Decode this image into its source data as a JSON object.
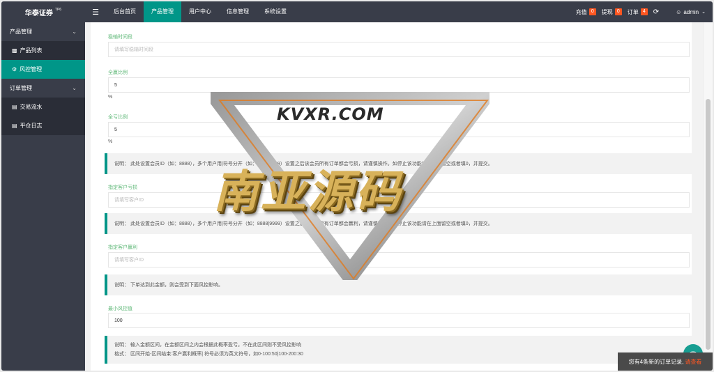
{
  "app": {
    "logo": "华泰证券",
    "logo_badge": "TP6"
  },
  "nav": {
    "toggle_icon": "hamburger-icon",
    "items": [
      {
        "label": "后台首页"
      },
      {
        "label": "产品管理"
      },
      {
        "label": "用户中心"
      },
      {
        "label": "信息管理"
      },
      {
        "label": "系统设置"
      }
    ],
    "active_index": 1
  },
  "top_right": {
    "recharge_label": "充值",
    "recharge_count": "0",
    "withdraw_label": "提现",
    "withdraw_count": "0",
    "order_label": "订单",
    "order_count": "4",
    "user": "admin"
  },
  "sidebar": {
    "groups": [
      {
        "label": "产品管理",
        "items": [
          {
            "label": "产品列表",
            "icon": "cube-icon"
          },
          {
            "label": "风控管理",
            "icon": "gear-icon",
            "active": true
          }
        ]
      },
      {
        "label": "订单管理",
        "items": [
          {
            "label": "交易流水",
            "icon": "list-icon"
          },
          {
            "label": "平仓日志",
            "icon": "list-icon"
          }
        ]
      }
    ]
  },
  "form": {
    "f1": {
      "label": "稳输时间段",
      "placeholder": "请填写稳输时间段",
      "value": ""
    },
    "f2": {
      "label": "全赢比例",
      "value": "5",
      "unit": "%"
    },
    "f3": {
      "label": "全亏比例",
      "value": "5",
      "unit": "%"
    },
    "note1": "说明： 此处设置会员ID（如：8888），多个用户用|符号分开（如：8888|9999）设置之后该会员所有订单都会亏损，请谨慎操作。如停止该功能请在上面留空或者填0，并提交。",
    "f4": {
      "label": "指定客户亏损",
      "placeholder": "请填写客户ID",
      "value": ""
    },
    "note2": "说明： 此处设置会员ID（如：8888），多个用户用|符号分开（如：8888|9999）设置之后该会员所有订单都会赢利，请谨慎操作。如停止该功能请在上面留空或者填0，并提交。",
    "f5": {
      "label": "指定客户赢利",
      "placeholder": "请填写客户ID",
      "value": ""
    },
    "note3": "说明： 下单达到此金额，则会受到下面风控影响。",
    "f6": {
      "label": "最小风控值",
      "value": "100"
    },
    "note4_line1": "说明： 输入金额区间，在金额区间之内会根据此概率盈亏。不在此区间则不受风控影响",
    "note4_line2": "格式： 区间开始-区间结束:客户赢利概率|      符号必须为英文符号，如0-100:50|100-200:30"
  },
  "watermark": {
    "url": "KVXR.COM",
    "title": "南亚源码"
  },
  "toast": {
    "text": "您有4条新的订单记录,",
    "link": "请查看"
  },
  "colors": {
    "topbar": "#393d49",
    "accent": "#009688",
    "badge": "#ff5722",
    "label_green": "#5fb878"
  }
}
